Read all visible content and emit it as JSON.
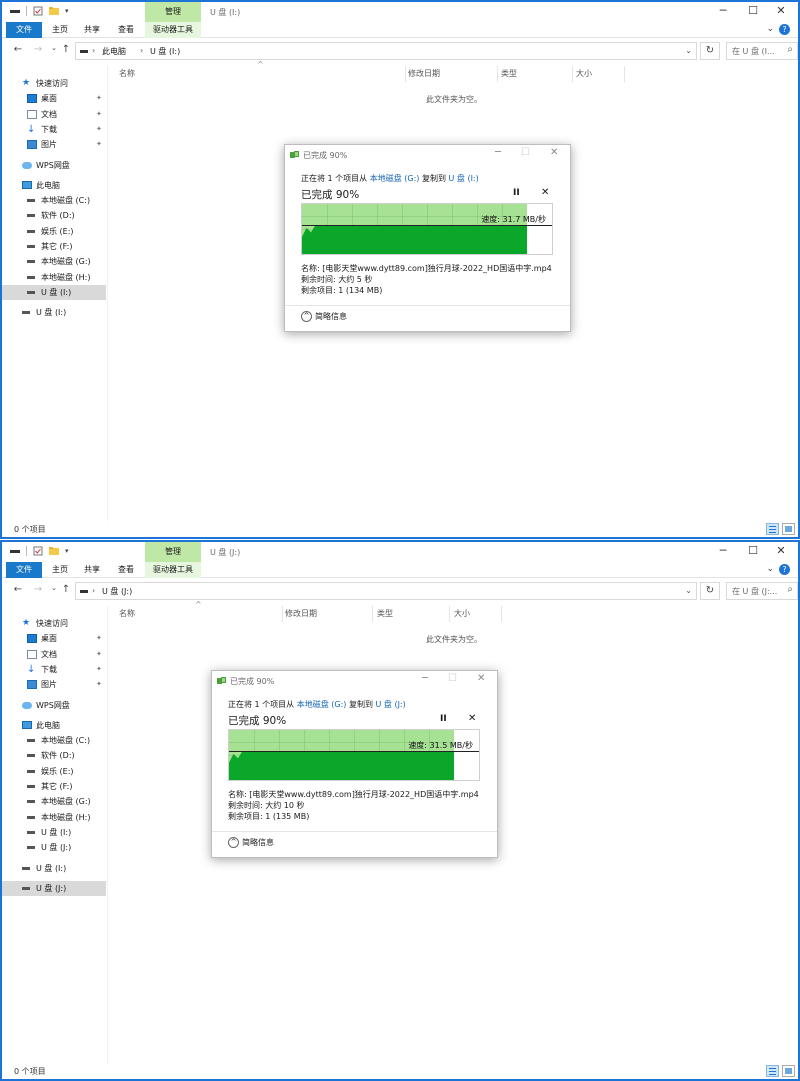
{
  "windows": [
    {
      "title": "U 盘 (I:)",
      "manage_tab": "管理",
      "ribbon": {
        "file": "文件",
        "home": "主页",
        "share": "共享",
        "view": "查看",
        "drive_tools": "驱动器工具"
      },
      "address": {
        "root": "此电脑",
        "current": "U 盘 (I:)"
      },
      "search_placeholder": "在 U 盘 (I...",
      "sidebar": [
        {
          "label": "快速访问",
          "icon": "star-icon",
          "indent": 0,
          "pinned": false,
          "selected": false
        },
        {
          "label": "桌面",
          "icon": "desktop-icon",
          "indent": 1,
          "pinned": true,
          "selected": false
        },
        {
          "label": "文档",
          "icon": "document-icon",
          "indent": 1,
          "pinned": true,
          "selected": false
        },
        {
          "label": "下载",
          "icon": "download-icon",
          "indent": 1,
          "pinned": true,
          "selected": false
        },
        {
          "label": "图片",
          "icon": "picture-icon",
          "indent": 1,
          "pinned": true,
          "selected": false
        },
        {
          "label": "WPS网盘",
          "icon": "cloud-icon",
          "indent": 0,
          "pinned": false,
          "selected": false,
          "gap": true
        },
        {
          "label": "此电脑",
          "icon": "computer-icon",
          "indent": 0,
          "pinned": false,
          "selected": false,
          "gap": true
        },
        {
          "label": "本地磁盘 (C:)",
          "icon": "drive-icon",
          "indent": 1,
          "pinned": false,
          "selected": false
        },
        {
          "label": "软件 (D:)",
          "icon": "drive-icon",
          "indent": 1,
          "pinned": false,
          "selected": false
        },
        {
          "label": "娱乐 (E:)",
          "icon": "drive-icon",
          "indent": 1,
          "pinned": false,
          "selected": false
        },
        {
          "label": "其它 (F:)",
          "icon": "drive-icon",
          "indent": 1,
          "pinned": false,
          "selected": false
        },
        {
          "label": "本地磁盘 (G:)",
          "icon": "drive-icon",
          "indent": 1,
          "pinned": false,
          "selected": false
        },
        {
          "label": "本地磁盘 (H:)",
          "icon": "drive-icon",
          "indent": 1,
          "pinned": false,
          "selected": false
        },
        {
          "label": "U 盘 (I:)",
          "icon": "drive-icon",
          "indent": 1,
          "pinned": false,
          "selected": true
        },
        {
          "label": "U 盘 (I:)",
          "icon": "drive-icon",
          "indent": 0,
          "pinned": false,
          "selected": false,
          "gap": true
        }
      ],
      "columns": [
        "名称",
        "修改日期",
        "类型",
        "大小"
      ],
      "empty_text": "此文件夹为空。",
      "status_count": "0 个项目",
      "dialog": {
        "title": "已完成 90%",
        "from_prefix": "正在将 1 个项目从",
        "source": "本地磁盘 (G:)",
        "to_word": "复制到",
        "dest": "U 盘 (I:)",
        "percent_text": "已完成 90%",
        "progress": 0.9,
        "speed_text": "速度: 31.7 MB/秒",
        "speed_level": 0.58,
        "name_line": "名称: [电影天堂www.dytt89.com]独行月球-2022_HD国语中字.mp4",
        "time_line": "剩余时间: 大约 5 秒",
        "items_line": "剩余项目: 1 (134 MB)",
        "more_label": "简略信息"
      }
    },
    {
      "title": "U 盘 (J:)",
      "manage_tab": "管理",
      "ribbon": {
        "file": "文件",
        "home": "主页",
        "share": "共享",
        "view": "查看",
        "drive_tools": "驱动器工具"
      },
      "address": {
        "root": "",
        "current": "U 盘 (J:)"
      },
      "search_placeholder": "在 U 盘 (J:...",
      "sidebar": [
        {
          "label": "快速访问",
          "icon": "star-icon",
          "indent": 0,
          "pinned": false,
          "selected": false
        },
        {
          "label": "桌面",
          "icon": "desktop-icon",
          "indent": 1,
          "pinned": true,
          "selected": false
        },
        {
          "label": "文档",
          "icon": "document-icon",
          "indent": 1,
          "pinned": true,
          "selected": false
        },
        {
          "label": "下载",
          "icon": "download-icon",
          "indent": 1,
          "pinned": true,
          "selected": false
        },
        {
          "label": "图片",
          "icon": "picture-icon",
          "indent": 1,
          "pinned": true,
          "selected": false
        },
        {
          "label": "WPS网盘",
          "icon": "cloud-icon",
          "indent": 0,
          "pinned": false,
          "selected": false,
          "gap": true
        },
        {
          "label": "此电脑",
          "icon": "computer-icon",
          "indent": 0,
          "pinned": false,
          "selected": false,
          "gap": true
        },
        {
          "label": "本地磁盘 (C:)",
          "icon": "drive-icon",
          "indent": 1,
          "pinned": false,
          "selected": false
        },
        {
          "label": "软件 (D:)",
          "icon": "drive-icon",
          "indent": 1,
          "pinned": false,
          "selected": false
        },
        {
          "label": "娱乐 (E:)",
          "icon": "drive-icon",
          "indent": 1,
          "pinned": false,
          "selected": false
        },
        {
          "label": "其它 (F:)",
          "icon": "drive-icon",
          "indent": 1,
          "pinned": false,
          "selected": false
        },
        {
          "label": "本地磁盘 (G:)",
          "icon": "drive-icon",
          "indent": 1,
          "pinned": false,
          "selected": false
        },
        {
          "label": "本地磁盘 (H:)",
          "icon": "drive-icon",
          "indent": 1,
          "pinned": false,
          "selected": false
        },
        {
          "label": "U 盘 (I:)",
          "icon": "drive-icon",
          "indent": 1,
          "pinned": false,
          "selected": false
        },
        {
          "label": "U 盘 (J:)",
          "icon": "drive-icon",
          "indent": 1,
          "pinned": false,
          "selected": false
        },
        {
          "label": "U 盘 (I:)",
          "icon": "drive-icon",
          "indent": 0,
          "pinned": false,
          "selected": false,
          "gap": true
        },
        {
          "label": "U 盘 (J:)",
          "icon": "drive-icon",
          "indent": 0,
          "pinned": false,
          "selected": true,
          "gap": true
        }
      ],
      "columns": [
        "名称",
        "修改日期",
        "类型",
        "大小"
      ],
      "empty_text": "此文件夹为空。",
      "status_count": "0 个项目",
      "dialog": {
        "title": "已完成 90%",
        "from_prefix": "正在将 1 个项目从",
        "source": "本地磁盘 (G:)",
        "to_word": "复制到",
        "dest": "U 盘 (J:)",
        "percent_text": "已完成 90%",
        "progress": 0.9,
        "speed_text": "速度: 31.5 MB/秒",
        "speed_level": 0.58,
        "name_line": "名称: [电影天堂www.dytt89.com]独行月球-2022_HD国语中字.mp4",
        "time_line": "剩余时间: 大约 10 秒",
        "items_line": "剩余项目: 1 (135 MB)",
        "more_label": "简略信息"
      }
    }
  ],
  "colors": {
    "accent": "#1979ca",
    "manage_tab": "#bfe8a7",
    "progress_light": "#a7e294",
    "progress_dark": "#0ba72a",
    "link": "#1565b5"
  }
}
